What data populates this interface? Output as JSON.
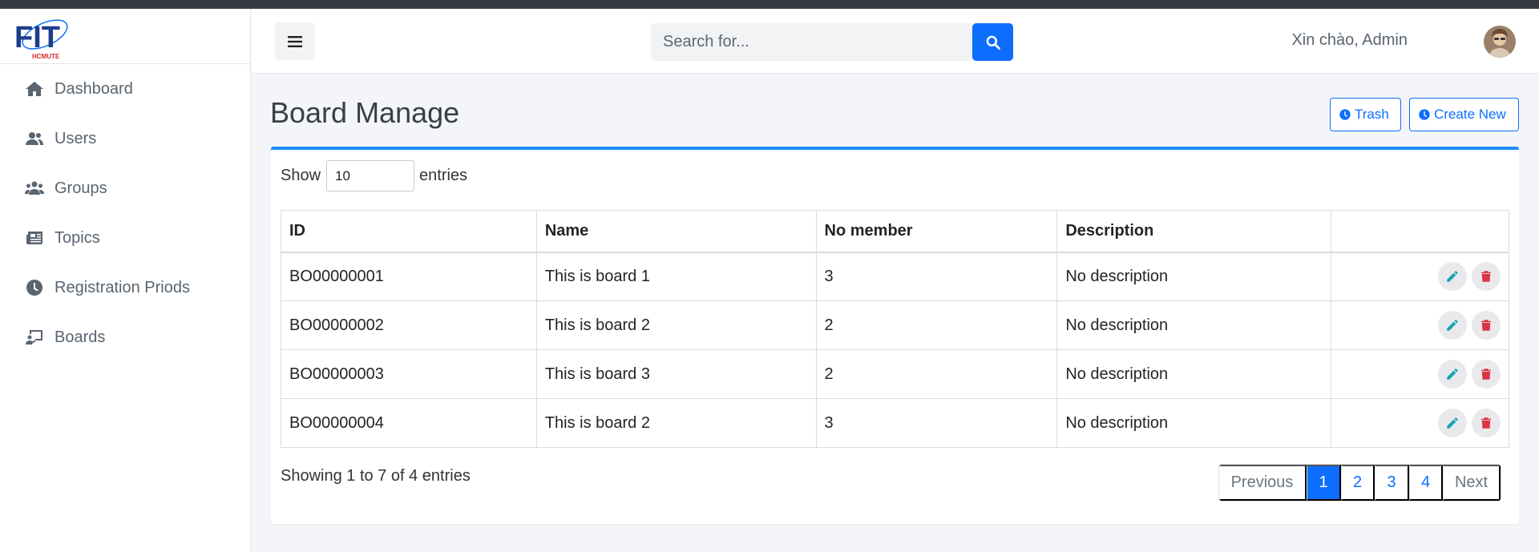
{
  "brand": {
    "logo_text": "FIT",
    "logo_sub": "HCMUTE"
  },
  "sidebar": {
    "items": [
      {
        "label": "Dashboard",
        "icon": "home-icon"
      },
      {
        "label": "Users",
        "icon": "users-icon"
      },
      {
        "label": "Groups",
        "icon": "groups-icon"
      },
      {
        "label": "Topics",
        "icon": "newspaper-icon"
      },
      {
        "label": "Registration Priods",
        "icon": "clock-icon"
      },
      {
        "label": "Boards",
        "icon": "board-icon"
      }
    ]
  },
  "header": {
    "search_placeholder": "Search for...",
    "greeting": "Xin chào, Admin"
  },
  "main": {
    "title": "Board Manage",
    "trash_label": "Trash",
    "create_label": "Create New",
    "show_label": "Show",
    "entries_value": "10",
    "entries_label": "entries",
    "columns": [
      "ID",
      "Name",
      "No member",
      "Description",
      ""
    ],
    "rows": [
      {
        "id": "BO00000001",
        "name": "This is board 1",
        "members": "3",
        "description": "No description"
      },
      {
        "id": "BO00000002",
        "name": "This is board 2",
        "members": "2",
        "description": "No description"
      },
      {
        "id": "BO00000003",
        "name": "This is board 3",
        "members": "2",
        "description": "No description"
      },
      {
        "id": "BO00000004",
        "name": "This is board 2",
        "members": "3",
        "description": "No description"
      }
    ],
    "info": "Showing 1 to 7 of 4 entries",
    "pagination": {
      "previous": "Previous",
      "pages": [
        "1",
        "2",
        "3",
        "4"
      ],
      "next": "Next",
      "current": "1"
    }
  },
  "colors": {
    "primary": "#0d6efd",
    "card_top": "#1a8cff",
    "edit_icon": "#17a2b8",
    "delete_icon": "#dc3545"
  }
}
